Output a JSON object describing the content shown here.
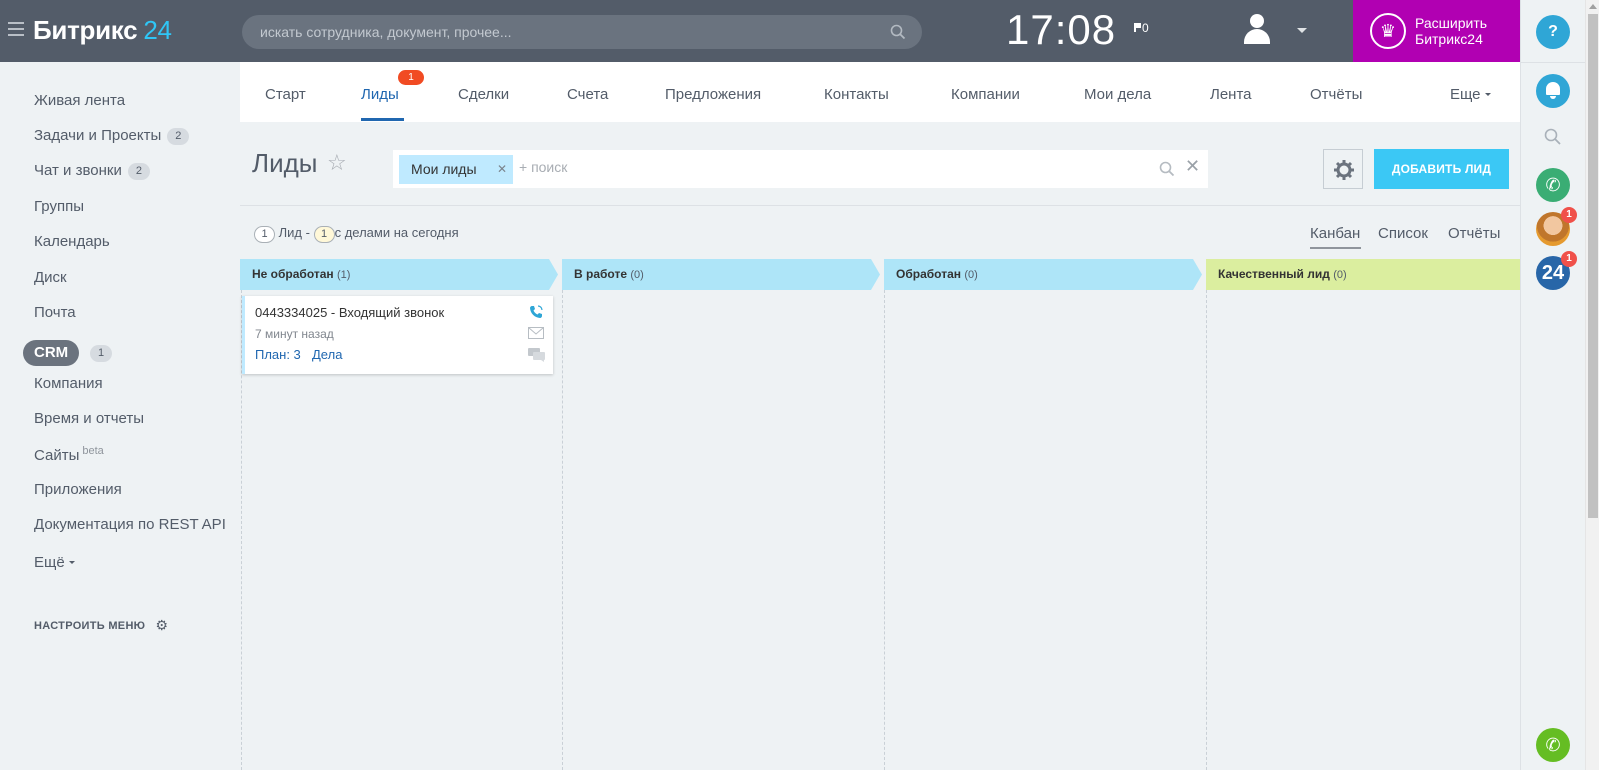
{
  "header": {
    "logo_name": "Битрикс",
    "logo_num": "24",
    "search_placeholder": "искать сотрудника, документ, прочее...",
    "clock": "17:08",
    "flag_count": "0",
    "upgrade_line1": "Расширить",
    "upgrade_line2": "Битрикс24"
  },
  "right_panel": {
    "help": "?",
    "logo24": "24",
    "avatar_badge": "1",
    "logo24_badge": "1"
  },
  "sidebar": {
    "items": [
      {
        "label": "Живая лента"
      },
      {
        "label": "Задачи и Проекты",
        "count": "2"
      },
      {
        "label": "Чат и звонки",
        "count": "2"
      },
      {
        "label": "Группы"
      },
      {
        "label": "Календарь"
      },
      {
        "label": "Диск"
      },
      {
        "label": "Почта"
      },
      {
        "label": "CRM",
        "count": "1"
      },
      {
        "label": "Компания"
      },
      {
        "label": "Время и отчеты"
      },
      {
        "label": "Сайты",
        "suffix": "beta"
      },
      {
        "label": "Приложения"
      },
      {
        "label": "Документация по REST API"
      },
      {
        "label": "Ещё"
      }
    ],
    "configure": "НАСТРОИТЬ МЕНЮ"
  },
  "tabs": [
    {
      "label": "Старт"
    },
    {
      "label": "Лиды",
      "active": true,
      "badge": "1"
    },
    {
      "label": "Сделки"
    },
    {
      "label": "Счета"
    },
    {
      "label": "Предложения"
    },
    {
      "label": "Контакты"
    },
    {
      "label": "Компании"
    },
    {
      "label": "Мои дела"
    },
    {
      "label": "Лента"
    },
    {
      "label": "Отчёты"
    },
    {
      "label": "Еще"
    }
  ],
  "page": {
    "title": "Лиды",
    "filter_chip": "Мои лиды",
    "filter_placeholder": "+ поиск",
    "add_button": "ДОБАВИТЬ ЛИД",
    "stats": {
      "leads_count": "1",
      "leads_text": "Лид -",
      "today_count": "1",
      "today_text": "с делами на сегодня"
    },
    "views": [
      "Канбан",
      "Список",
      "Отчёты"
    ],
    "active_view": "Канбан"
  },
  "kanban": {
    "columns": [
      {
        "title": "Не обработан",
        "count": "(1)",
        "color": "#aee5f8"
      },
      {
        "title": "В работе",
        "count": "(0)",
        "color": "#aee5f8"
      },
      {
        "title": "Обработан",
        "count": "(0)",
        "color": "#aee5f8"
      },
      {
        "title": "Качественный лид",
        "count": "(0)",
        "color": "#dbee9f"
      }
    ],
    "cards": [
      {
        "title": "0443334025 - Входящий звонок",
        "time": "7 минут назад",
        "plan": "План: 3",
        "deals": "Дела"
      }
    ]
  },
  "colors": {
    "header_bg": "#535c69",
    "accent_blue": "#3bc8f5",
    "upgrade_purple": "#b100b2",
    "link_blue": "#2067b0"
  }
}
